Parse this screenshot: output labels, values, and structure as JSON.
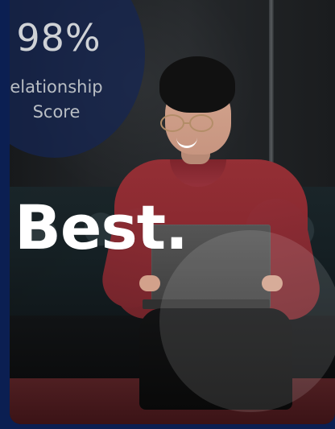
{
  "hero": {
    "stat_value": "98%",
    "stat_label_line1": "elationship",
    "stat_label_line2": "Score",
    "headline": "Best."
  }
}
